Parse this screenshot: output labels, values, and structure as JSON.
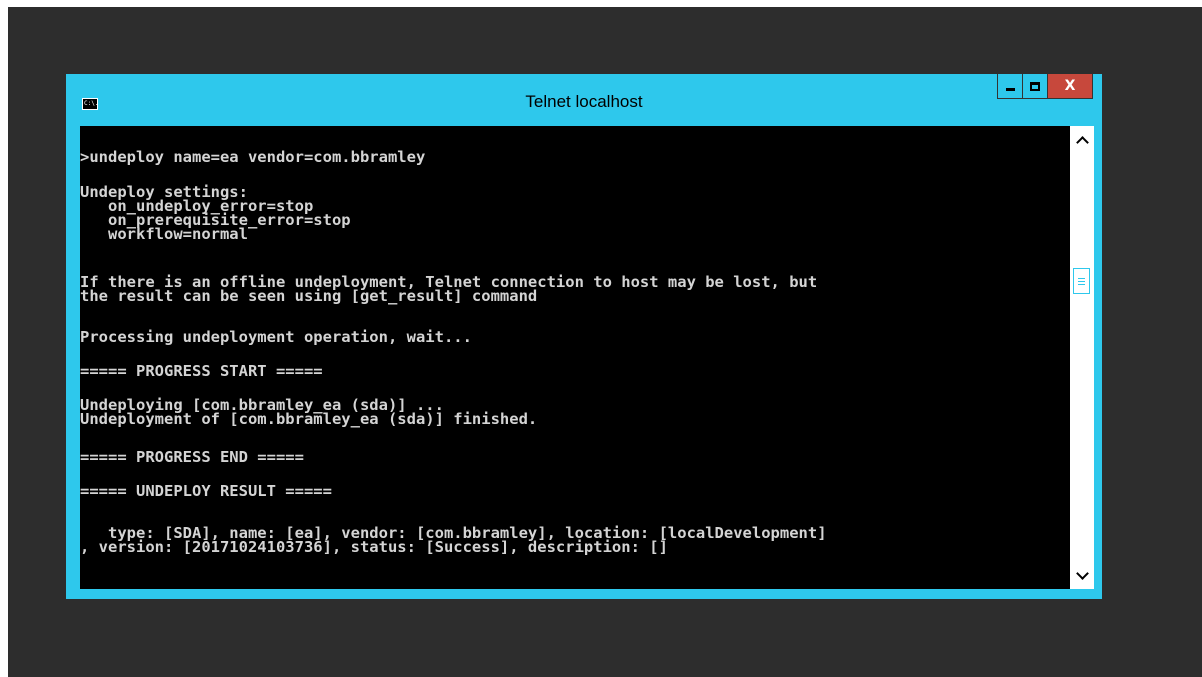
{
  "window": {
    "title": "Telnet localhost",
    "icon": "console-icon",
    "icon_text": "C:\\.",
    "controls": {
      "minimize_icon": "minimize-icon",
      "maximize_icon": "maximize-icon",
      "close_label": "X"
    }
  },
  "console": {
    "lines": [
      ">undeploy name=ea vendor=com.bbramley",
      "",
      "Undeploy settings:",
      "   on_undeploy_error=stop",
      "   on_prerequisite_error=stop",
      "   workflow=normal",
      "",
      "If there is an offline undeployment, Telnet connection to host may be lost, but",
      "the result can be seen using [get_result] command",
      "",
      "Processing undeployment operation, wait...",
      "",
      "===== PROGRESS START =====",
      "",
      "Undeploying [com.bbramley_ea (sda)] ...",
      "Undeployment of [com.bbramley_ea (sda)] finished.",
      "",
      "===== PROGRESS END =====",
      "",
      "===== UNDEPLOY RESULT =====",
      "",
      "",
      "   type: [SDA], name: [ea], vendor: [com.bbramley], location: [localDevelopment]",
      ", version: [20171024103736], status: [Success], description: []"
    ]
  },
  "scrollbar": {
    "up_icon": "scroll-up-arrow-icon",
    "down_icon": "scroll-down-arrow-icon",
    "position": 0.3
  },
  "colors": {
    "window_frame": "#2ec8ec",
    "desktop": "#2d2d2d",
    "console_background": "#000000",
    "console_text": "#d4d4d4",
    "close_button": "#c7483c"
  }
}
